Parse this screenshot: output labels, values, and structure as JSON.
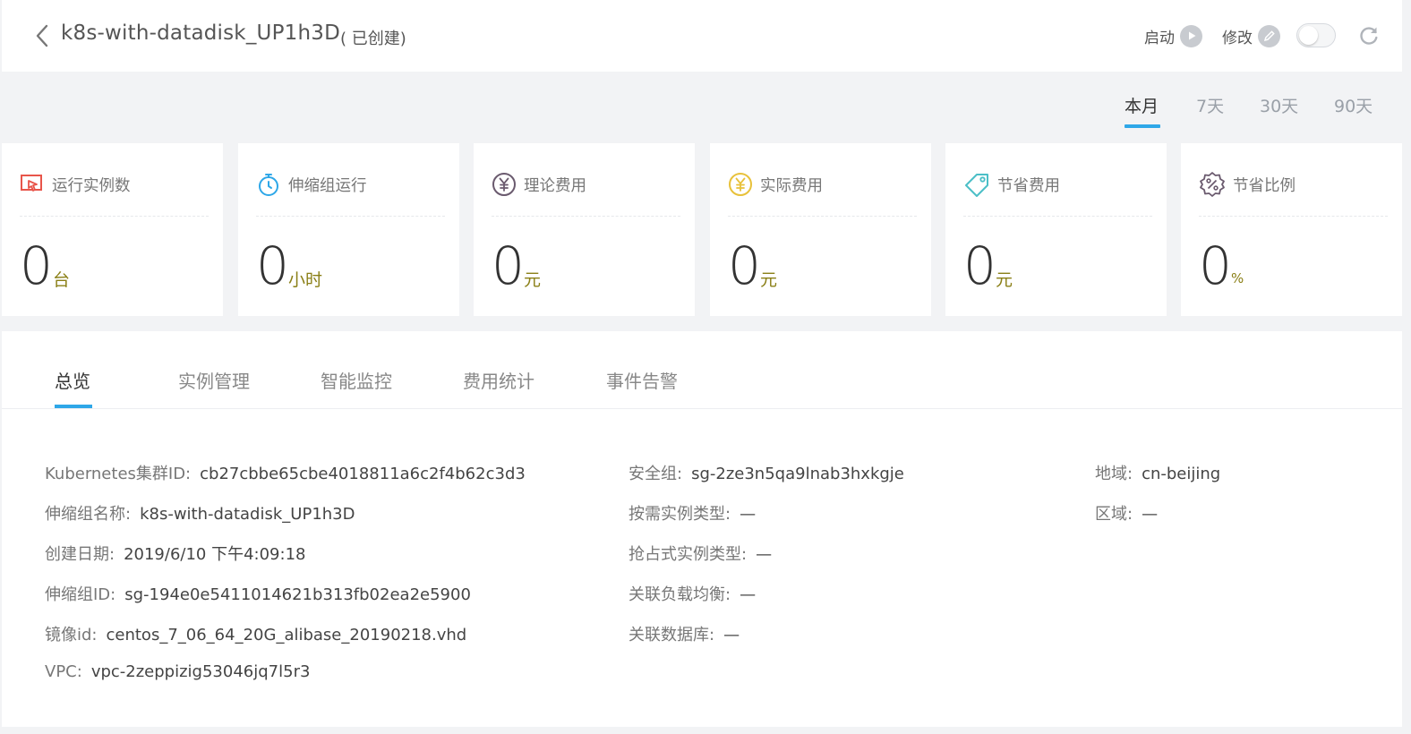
{
  "header": {
    "title": "k8s-with-datadisk_UP1h3D",
    "status": "( 已创建)",
    "start_label": "启动",
    "edit_label": "修改"
  },
  "period_tabs": [
    "本月",
    "7天",
    "30天",
    "90天"
  ],
  "active_period": "本月",
  "stats": [
    {
      "label": "运行实例数",
      "value": "0",
      "unit": "台",
      "icon": "monitor-icon",
      "color": "#e8554a"
    },
    {
      "label": "伸缩组运行",
      "value": "0",
      "unit": "小时",
      "icon": "stopwatch-icon",
      "color": "#2ea7e8"
    },
    {
      "label": "理论费用",
      "value": "0",
      "unit": "元",
      "icon": "yuan-icon",
      "color": "#6a5a6e"
    },
    {
      "label": "实际费用",
      "value": "0",
      "unit": "元",
      "icon": "yuan-icon",
      "color": "#e8c13a"
    },
    {
      "label": "节省费用",
      "value": "0",
      "unit": "元",
      "icon": "tag-icon",
      "color": "#4bbfc7"
    },
    {
      "label": "节省比例",
      "value": "0",
      "unit": "%",
      "icon": "percent-badge-icon",
      "color": "#6a5a6e"
    }
  ],
  "tabs": [
    "总览",
    "实例管理",
    "智能监控",
    "费用统计",
    "事件告警"
  ],
  "active_tab": "总览",
  "details": {
    "col1": [
      {
        "label": "Kubernetes集群ID:",
        "value": "cb27cbbe65cbe4018811a6c2f4b62c3d3"
      },
      {
        "label": "伸缩组名称:",
        "value": "k8s-with-datadisk_UP1h3D"
      },
      {
        "label": "创建日期:",
        "value": "2019/6/10 下午4:09:18"
      },
      {
        "label": "伸缩组ID:",
        "value": "sg-194e0e5411014621b313fb02ea2e5900"
      },
      {
        "label": "镜像id:",
        "value": "centos_7_06_64_20G_alibase_20190218.vhd"
      },
      {
        "label": "VPC:",
        "value": "vpc-2zeppizig53046jq7l5r3"
      }
    ],
    "col2": [
      {
        "label": "安全组:",
        "value": "sg-2ze3n5qa9lnab3hxkgje"
      },
      {
        "label": "按需实例类型:",
        "value": "—"
      },
      {
        "label": "抢占式实例类型:",
        "value": "—"
      },
      {
        "label": "关联负载均衡:",
        "value": "—"
      },
      {
        "label": "关联数据库:",
        "value": "—"
      }
    ],
    "col3": [
      {
        "label": "地域:",
        "value": "cn-beijing"
      },
      {
        "label": "区域:",
        "value": "—"
      }
    ]
  }
}
